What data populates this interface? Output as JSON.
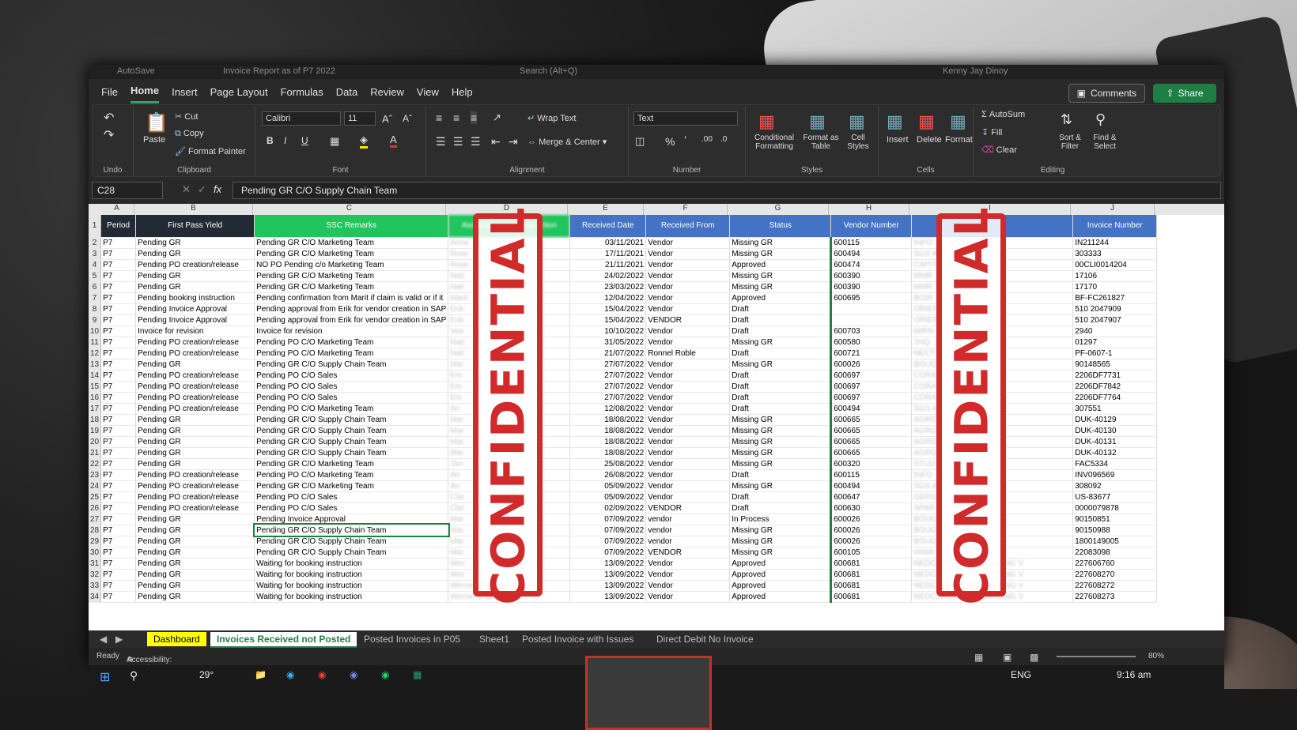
{
  "titlebar": {
    "autosave": "AutoSave",
    "filename": "Invoice Report as of P7 2022",
    "search": "Search (Alt+Q)",
    "user": "Kenny Jay Dinoy"
  },
  "menu": {
    "tabs": [
      "File",
      "Home",
      "Insert",
      "Page Layout",
      "Formulas",
      "Data",
      "Review",
      "View",
      "Help"
    ],
    "active": "Home",
    "comments": "Comments",
    "share": "Share"
  },
  "ribbon": {
    "undo": "Undo",
    "clipboard": {
      "label": "Clipboard",
      "paste": "Paste",
      "cut": "Cut",
      "copy": "Copy",
      "format_painter": "Format Painter"
    },
    "font": {
      "label": "Font",
      "name": "Calibri",
      "size": "11",
      "bold": "B",
      "italic": "I",
      "underline": "U"
    },
    "alignment": {
      "label": "Alignment",
      "wrap": "Wrap Text",
      "merge": "Merge & Center"
    },
    "number": {
      "label": "Number",
      "format": "Text"
    },
    "styles": {
      "label": "Styles",
      "conditional": "Conditional Formatting",
      "format_table": "Format as Table",
      "cell_styles": "Cell Styles"
    },
    "cells": {
      "label": "Cells",
      "insert": "Insert",
      "delete": "Delete",
      "format": "Format"
    },
    "editing": {
      "label": "Editing",
      "autosum": "AutoSum",
      "fill": "Fill",
      "clear": "Clear",
      "sort": "Sort & Filter",
      "find": "Find & Select"
    }
  },
  "formula_bar": {
    "cell": "C28",
    "content": "Pending GR C/O Supply Chain Team"
  },
  "columns": [
    "A",
    "B",
    "C",
    "D",
    "E",
    "F",
    "G",
    "H",
    "I",
    "J"
  ],
  "headers": {
    "period": "Period",
    "fpy": "First Pass Yield",
    "ssc": "SSC Remarks",
    "assigned": "Assigned to/pending action",
    "received_date": "Received Date",
    "received_from": "Received From",
    "status": "Status",
    "vendor_number": "Vendor Number",
    "invoice_number": "Invoice Number"
  },
  "rows": [
    [
      "2",
      "P7",
      "Pending GR",
      "Pending GR C/O Marketing Team",
      "Anna",
      "03/11/2021",
      "Vendor",
      "Missing GR",
      "600115",
      "INFO",
      "IN211244"
    ],
    [
      "3",
      "P7",
      "Pending GR",
      "Pending GR C/O Marketing Team",
      "Rose",
      "17/11/2021",
      "Vendor",
      "Missing GR",
      "600494",
      "SGS A",
      "303333"
    ],
    [
      "4",
      "P7",
      "Pending PO creation/release",
      "NO PO Pending c/o Marketing Team",
      "Rose",
      "21/11/2021",
      "Vendor",
      "Approved",
      "600474",
      "CAPIT",
      "00CLI0014204"
    ],
    [
      "5",
      "P7",
      "Pending GR",
      "Pending GR C/O Marketing Team",
      "Nati",
      "24/02/2022",
      "Vendor",
      "Missing GR",
      "600390",
      "MMR",
      "17106"
    ],
    [
      "6",
      "P7",
      "Pending GR",
      "Pending GR C/O Marketing Team",
      "Nati",
      "23/03/2022",
      "Vendor",
      "Missing GR",
      "600390",
      "MMR",
      "17170"
    ],
    [
      "7",
      "P7",
      "Pending booking instruction",
      "Pending confirmation from Marit if claim is valid or if it",
      "Marit",
      "12/04/2022",
      "Vendor",
      "Approved",
      "600695",
      "BOIR",
      "BF-FC261827"
    ],
    [
      "8",
      "P7",
      "Pending Invoice Approval",
      "Pending approval from Erik for vendor creation in SAP",
      "Erik",
      "15/04/2022",
      "Vendor",
      "Draft",
      "",
      "ORIEN",
      "510 2047909"
    ],
    [
      "9",
      "P7",
      "Pending Invoice Approval",
      "Pending approval from Erik for vendor creation in SAP",
      "Erik",
      "15/04/2022",
      "VENDOR",
      "Draft",
      "",
      "ORIEN",
      "510 2047907"
    ],
    [
      "10",
      "P7",
      "Invoice for revision",
      "Invoice for revision",
      "Vee",
      "10/10/2022",
      "Vendor",
      "Draft",
      "600703",
      "MIRN",
      "2940"
    ],
    [
      "11",
      "P7",
      "Pending PO creation/release",
      "Pending PO C/O Marketing Team",
      "Nati",
      "31/05/2022",
      "Vendor",
      "Missing GR",
      "600580",
      "1HQ",
      "01297"
    ],
    [
      "12",
      "P7",
      "Pending PO creation/release",
      "Pending PO C/O Marketing Team",
      "Nati",
      "21/07/2022",
      "Ronnel Roble",
      "Draft",
      "600721",
      "NECT",
      "PF-0607-1"
    ],
    [
      "13",
      "P7",
      "Pending GR",
      "Pending GR C/O Supply Chain Team",
      "Mar",
      "27/07/2022",
      "Vendor",
      "Missing GR",
      "600026",
      "BOUG",
      "90148565"
    ],
    [
      "14",
      "P7",
      "Pending PO creation/release",
      "Pending PO C/O Sales",
      "Em",
      "27/07/2022",
      "Vendor",
      "Draft",
      "600697",
      "CORA",
      "2206DF7731"
    ],
    [
      "15",
      "P7",
      "Pending PO creation/release",
      "Pending PO C/O Sales",
      "Em",
      "27/07/2022",
      "Vendor",
      "Draft",
      "600697",
      "CORA",
      "2206DF7842"
    ],
    [
      "16",
      "P7",
      "Pending PO creation/release",
      "Pending PO C/O Sales",
      "Em",
      "27/07/2022",
      "Vendor",
      "Draft",
      "600697",
      "CORA",
      "2206DF7764"
    ],
    [
      "17",
      "P7",
      "Pending PO creation/release",
      "Pending PO C/O Marketing Team",
      "An",
      "12/08/2022",
      "Vendor",
      "Draft",
      "600494",
      "SGS A",
      "307551"
    ],
    [
      "18",
      "P7",
      "Pending GR",
      "Pending GR C/O Supply Chain Team",
      "Mar",
      "18/08/2022",
      "Vendor",
      "Missing GR",
      "600665",
      "AGRO",
      "DUK-40129"
    ],
    [
      "19",
      "P7",
      "Pending GR",
      "Pending GR C/O Supply Chain Team",
      "Mar",
      "18/08/2022",
      "Vendor",
      "Missing GR",
      "600665",
      "AGRO",
      "DUK-40130"
    ],
    [
      "20",
      "P7",
      "Pending GR",
      "Pending GR C/O Supply Chain Team",
      "Mar",
      "18/08/2022",
      "Vendor",
      "Missing GR",
      "600665",
      "AGRO",
      "DUK-40131"
    ],
    [
      "21",
      "P7",
      "Pending GR",
      "Pending GR C/O Supply Chain Team",
      "Mar",
      "18/08/2022",
      "Vendor",
      "Missing GR",
      "600665",
      "AGRO",
      "DUK-40132"
    ],
    [
      "22",
      "P7",
      "Pending GR",
      "Pending GR C/O Marketing Team",
      "Tan",
      "25/08/2022",
      "Vendor",
      "Missing GR",
      "600320",
      "STUD",
      "FAC5334"
    ],
    [
      "23",
      "P7",
      "Pending PO creation/release",
      "Pending PO C/O Marketing Team",
      "An",
      "26/08/2022",
      "Vendor",
      "Draft",
      "600115",
      "INFO",
      "INV096569"
    ],
    [
      "24",
      "P7",
      "Pending PO creation/release",
      "Pending GR C/O Marketing Team",
      "An",
      "05/09/2022",
      "Vendor",
      "Missing GR",
      "600494",
      "SGS A",
      "308092"
    ],
    [
      "25",
      "P7",
      "Pending PO creation/release",
      "Pending PO C/O Sales",
      "Clai",
      "05/09/2022",
      "Vendor",
      "Draft",
      "600647",
      "GERS",
      "US-83677"
    ],
    [
      "26",
      "P7",
      "Pending PO creation/release",
      "Pending PO C/O Sales",
      "Clai",
      "02/09/2022",
      "VENDOR",
      "Draft",
      "600630",
      "SPAR",
      "0000079878"
    ],
    [
      "27",
      "P7",
      "Pending GR",
      "Pending Invoice Approval",
      "Mar",
      "07/09/2022",
      "vendor",
      "In Process",
      "600026",
      "BOUG",
      "90150851"
    ],
    [
      "28",
      "P7",
      "Pending GR",
      "Pending GR C/O Supply Chain Team",
      "Mar",
      "07/09/2022",
      "vendor",
      "Missing GR",
      "600026",
      "BOUG",
      "90150988"
    ],
    [
      "29",
      "P7",
      "Pending GR",
      "Pending GR C/O Supply Chain Team",
      "Mar",
      "07/09/2022",
      "vendor",
      "Missing GR",
      "600026",
      "BOUG",
      "1800149005"
    ],
    [
      "30",
      "P7",
      "Pending GR",
      "Pending GR C/O Supply Chain Team",
      "Mar",
      "07/09/2022",
      "VENDOR",
      "Missing GR",
      "600105",
      "HIWA",
      "22083098"
    ],
    [
      "31",
      "P7",
      "Pending GR",
      "Waiting for booking instruction",
      "Wer",
      "13/09/2022",
      "Vendor",
      "Approved",
      "600681",
      "NEDCARGO FORWARDING V",
      "227606760"
    ],
    [
      "32",
      "P7",
      "Pending GR",
      "Waiting for booking instruction",
      "Wer",
      "13/09/2022",
      "Vendor",
      "Approved",
      "600681",
      "NEDCARGO FORWARDING V",
      "227608270"
    ],
    [
      "33",
      "P7",
      "Pending GR",
      "Waiting for booking instruction",
      "Werner Dupreez",
      "13/09/2022",
      "Vendor",
      "Approved",
      "600681",
      "NEDCARGO FORWARDING V",
      "227608272"
    ],
    [
      "34",
      "P7",
      "Pending GR",
      "Waiting for booking instruction",
      "Werner Dupreez",
      "13/09/2022",
      "Vendor",
      "Approved",
      "600681",
      "NEDCARGO FORWARDING V",
      "227608273"
    ]
  ],
  "stamp": "CONFIDENTIAL",
  "sheets": [
    "Dashboard",
    "Invoices Received not Posted",
    "Posted Invoices in P05",
    "Sheet1",
    "Posted Invoice with Issues",
    "Direct Debit No Invoice"
  ],
  "status": {
    "ready": "Ready",
    "accessibility": "Accessibility: Investigate",
    "zoom": "80%"
  },
  "taskbar": {
    "weather": "29°",
    "lang": "ENG",
    "time": "9:16 am"
  },
  "colors": {
    "excel_green": "#1e7f45",
    "stamp_red": "#d02a2a",
    "hdr_dark": "#222b35",
    "hdr_green": "#21c55d",
    "hdr_blue": "#4472c4"
  }
}
